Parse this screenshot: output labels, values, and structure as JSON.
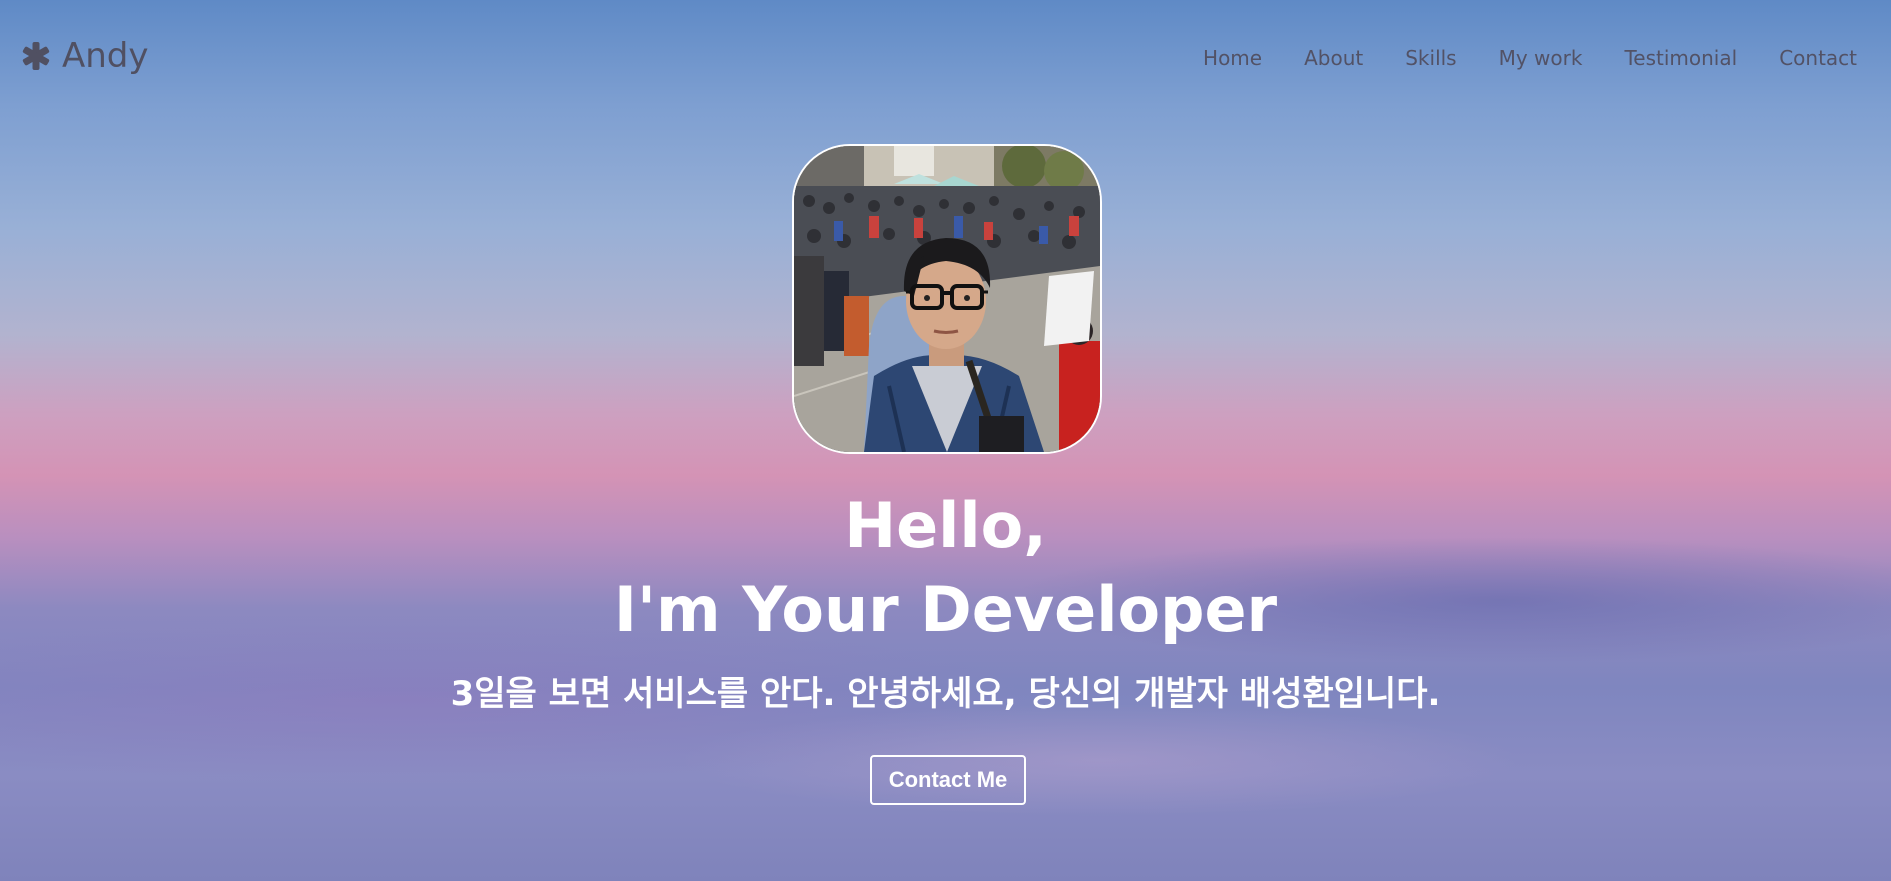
{
  "navbar": {
    "brand": {
      "icon": "asterisk-icon",
      "text": "Andy"
    },
    "links": [
      {
        "label": "Home"
      },
      {
        "label": "About"
      },
      {
        "label": "Skills"
      },
      {
        "label": "My work"
      },
      {
        "label": "Testimonial"
      },
      {
        "label": "Contact"
      }
    ]
  },
  "hero": {
    "avatar": "profile-photo",
    "title_line1": "Hello,",
    "title_line2": "I'm Your Developer",
    "subtitle": "3일을 보면 서비스를 안다. 안녕하세요, 당신의 개발자 배성환입니다.",
    "cta_label": "Contact Me"
  },
  "colors": {
    "text_dark": "#505062",
    "text_light": "#ffffff",
    "sky_top": "#5f8ac6",
    "sky_pink": "#d493b5",
    "sky_bottom": "#7f83bb"
  }
}
